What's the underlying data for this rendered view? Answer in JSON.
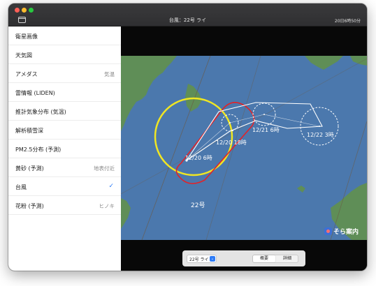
{
  "window": {
    "title": "台風：22号 ライ",
    "time": "20日6時50分"
  },
  "sidebar": {
    "items": [
      {
        "label": "衛星画像",
        "value": "",
        "selected": false
      },
      {
        "label": "天気図",
        "value": "",
        "selected": false
      },
      {
        "label": "アメダス",
        "value": "気温",
        "selected": false
      },
      {
        "label": "雷情報 (LIDEN)",
        "value": "",
        "selected": false
      },
      {
        "label": "推計気象分布 (気温)",
        "value": "",
        "selected": false
      },
      {
        "label": "解析積雪深",
        "value": "",
        "selected": false
      },
      {
        "label": "PM2.5分布 (予測)",
        "value": "",
        "selected": false
      },
      {
        "label": "黄砂 (予測)",
        "value": "地表付近",
        "selected": false
      },
      {
        "label": "台風",
        "value": "✓",
        "selected": true
      },
      {
        "label": "花粉 (予測)",
        "value": "ヒノキ",
        "selected": false
      }
    ]
  },
  "map": {
    "forecast_labels": [
      "12/20 6時",
      "12/20 18時",
      "12/21 6時",
      "12/22 3時"
    ],
    "storm_label": "22号",
    "brand": "そら案内",
    "colors": {
      "ocean": "#4b78ad",
      "land": "#5f8e57",
      "storm_warning_circle": "#f0e623",
      "storm_strong_area": "#e0242a",
      "forecast_circle": "#ffffff"
    }
  },
  "controls": {
    "storm_select": "22号 ライ",
    "segment_summary": "概要",
    "segment_detail": "詳細"
  }
}
